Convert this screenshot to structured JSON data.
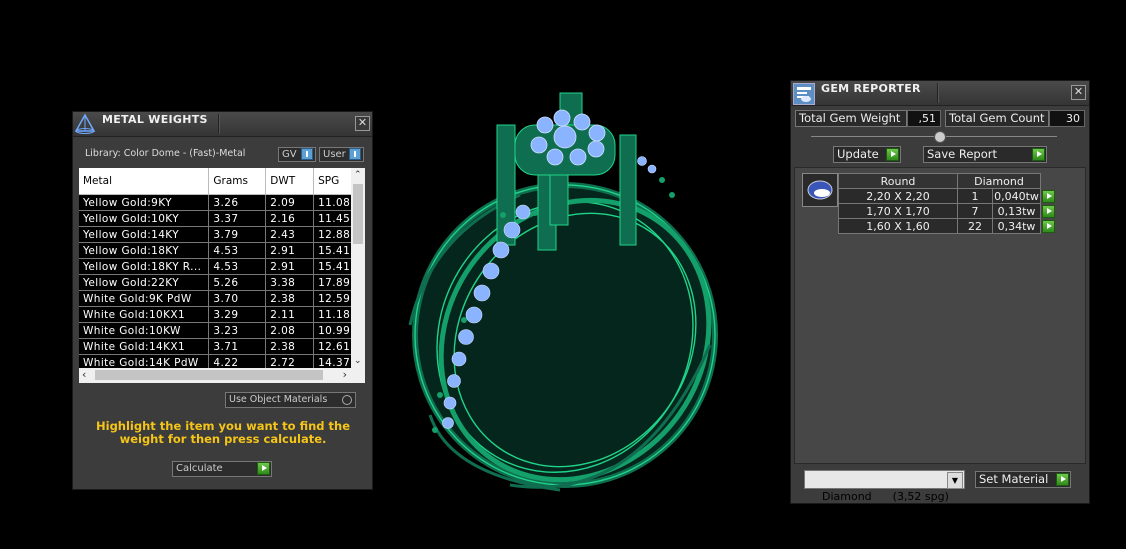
{
  "metal_panel": {
    "title": "METAL WEIGHTS",
    "library": "Library: Color Dome - (Fast)-Metal",
    "gv_label": "GV",
    "user_label": "User",
    "columns": [
      "Metal",
      "Grams",
      "DWT",
      "SPG"
    ],
    "rows": [
      [
        "Yellow Gold:9KY",
        "3.26",
        "2.09",
        "11.08"
      ],
      [
        "Yellow Gold:10KY",
        "3.37",
        "2.16",
        "11.45"
      ],
      [
        "Yellow Gold:14KY",
        "3.79",
        "2.43",
        "12.88"
      ],
      [
        "Yellow Gold:18KY",
        "4.53",
        "2.91",
        "15.41"
      ],
      [
        "Yellow Gold:18KY R...",
        "4.53",
        "2.91",
        "15.41"
      ],
      [
        "Yellow Gold:22KY",
        "5.26",
        "3.38",
        "17.89"
      ],
      [
        "White Gold:9K PdW",
        "3.70",
        "2.38",
        "12.59"
      ],
      [
        "White Gold:10KX1",
        "3.29",
        "2.11",
        "11.18"
      ],
      [
        "White Gold:10KW",
        "3.23",
        "2.08",
        "10.99"
      ],
      [
        "White Gold:14KX1",
        "3.71",
        "2.38",
        "12.61"
      ],
      [
        "White Gold:14K PdW",
        "4.22",
        "2.72",
        "14.37"
      ]
    ],
    "use_object_materials": "Use Object Materials",
    "instruction": "Highlight the item you want to find the weight for then press calculate.",
    "calculate_label": "Calculate"
  },
  "gem_panel": {
    "title": "GEM REPORTER",
    "total_weight_label": "Total Gem Weight",
    "total_weight_value": ",51",
    "total_count_label": "Total Gem Count",
    "total_count_value": "30",
    "update_label": "Update",
    "save_report_label": "Save Report",
    "headers": [
      "Round",
      "Diamond"
    ],
    "rows": [
      [
        "2,20 X 2,20",
        "1",
        "0,040tw"
      ],
      [
        "1,70 X 1,70",
        "7",
        "0,13tw"
      ],
      [
        "1,60 X 1,60",
        "22",
        "0,34tw"
      ]
    ],
    "material_select": "Diamond      (3,52 spg)",
    "set_material_label": "Set Material"
  },
  "colors": {
    "ring": "#0f6e4f",
    "ring_line": "#1fd48a",
    "gem": "#8ab4ff",
    "instruction": "#f5c518"
  }
}
